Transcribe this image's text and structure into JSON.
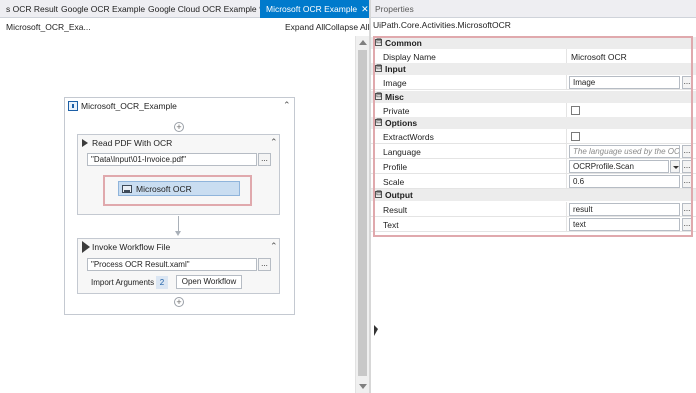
{
  "designer": {
    "tabs": [
      {
        "label": "s OCR Result"
      },
      {
        "label": "Google OCR Example"
      },
      {
        "label": "Google Cloud OCR Example *"
      },
      {
        "label": "Microsoft OCR Example",
        "close": "✕"
      }
    ],
    "doc_title": "Microsoft_OCR_Exa...",
    "expand_all": "Expand All",
    "collapse_all": "Collapse All",
    "sequence": {
      "title": "Microsoft_OCR_Example",
      "collapse_glyph": "⌃"
    },
    "read_pdf": {
      "title": "Read PDF With OCR",
      "path_value": "\"Data\\Input\\01-Invoice.pdf\"",
      "dots": "..."
    },
    "ocr_activity": {
      "label": "Microsoft OCR"
    },
    "invoke": {
      "title": "Invoke Workflow File",
      "file_value": "\"Process OCR Result.xaml\"",
      "dots": "...",
      "import_args_label": "Import Arguments",
      "import_args_count": "2",
      "open_workflow_label": "Open Workflow"
    },
    "plus_glyph": "+"
  },
  "properties": {
    "panel_title": "Properties",
    "activity_type": "UiPath.Core.Activities.MicrosoftOCR",
    "toggle_glyph": "⊟",
    "dots": "...",
    "categories": {
      "common": "Common",
      "input": "Input",
      "misc": "Misc",
      "options": "Options",
      "output": "Output"
    },
    "rows": {
      "display_name": {
        "name": "Display Name",
        "value": "Microsoft OCR"
      },
      "image": {
        "name": "Image",
        "value": "Image"
      },
      "private": {
        "name": "Private"
      },
      "extract_words": {
        "name": "ExtractWords"
      },
      "language": {
        "name": "Language",
        "placeholder": "The language used by the OCR e"
      },
      "profile": {
        "name": "Profile",
        "value": "OCRProfile.Scan"
      },
      "scale": {
        "name": "Scale",
        "value": "0.6"
      },
      "result": {
        "name": "Result",
        "value": "result"
      },
      "text": {
        "name": "Text",
        "value": "text"
      }
    }
  },
  "colors": {
    "active_tab": "#007acc",
    "highlight_border": "#e0a9ad",
    "selected_activity": "#c9ddf1"
  }
}
